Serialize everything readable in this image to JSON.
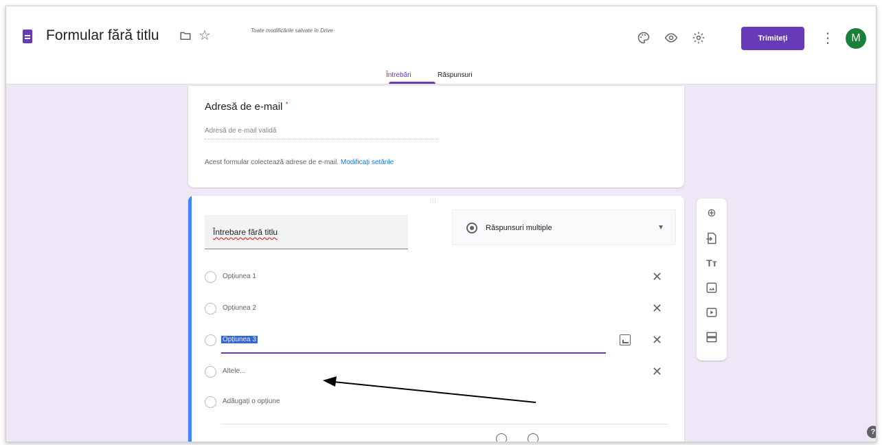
{
  "header": {
    "title": "Formular fără titlu",
    "saved_status": "Toate modificările salvate în Drive",
    "send_label": "Trimiteți",
    "avatar_letter": "M",
    "icons": [
      "doc-icon",
      "folder-icon",
      "star-icon",
      "palette-icon",
      "preview-eye-icon",
      "settings-gear-icon",
      "more-vert-icon"
    ]
  },
  "tabs": [
    {
      "label": "Întrebări",
      "active": true
    },
    {
      "label": "Răspunsuri",
      "active": false
    }
  ],
  "email_card": {
    "title": "Adresă de e-mail",
    "required_mark": "*",
    "placeholder": "Adresă de e-mail validă",
    "note": "Acest formular colectează adrese de e-mail.",
    "note_link": "Modificați setările"
  },
  "question": {
    "title": "Întrebare fără titlu",
    "type": "Răspunsuri multiple",
    "options": [
      "Opțiunea 1",
      "Opțiunea 2",
      "Opțiunea 3"
    ],
    "other_label": "Altele...",
    "add_option": "Adăugați o opțiune"
  },
  "side_toolbar": [
    "add-question-icon",
    "import-questions-icon",
    "add-title-icon",
    "add-image-icon",
    "add-video-icon",
    "add-section-icon"
  ],
  "colors": {
    "accent": "#673ab7",
    "background": "#efe7f6",
    "active_bar": "#4285f4",
    "avatar": "#188038"
  }
}
